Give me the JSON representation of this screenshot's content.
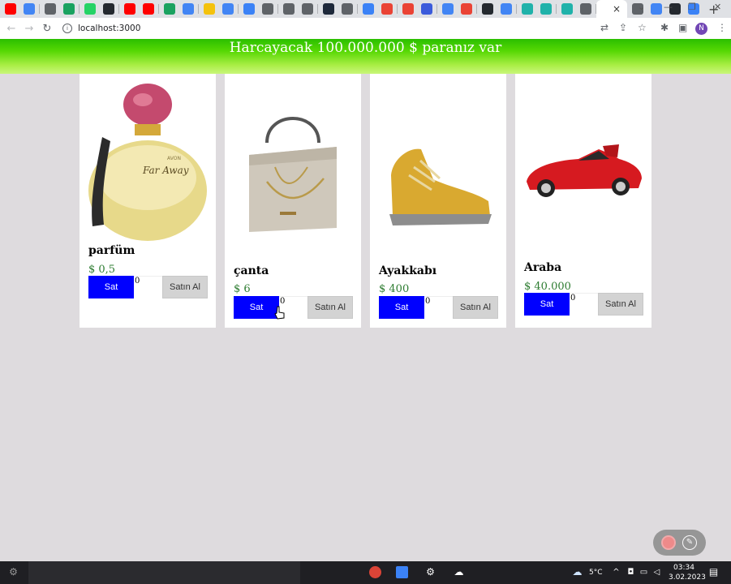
{
  "browser": {
    "url": "localhost:3000",
    "profile_initial": "N",
    "tab_favicon_colors": [
      "#ff0000",
      "#4285f4",
      "#5f6368",
      "#1aa260",
      "#25d366",
      "#24292f",
      "#ff0000",
      "#ff0000",
      "#1aa260",
      "#4285f4",
      "#f4c20d",
      "#4285f4",
      "#3b82f6",
      "#5f6368",
      "#5f6368",
      "#5f6368",
      "#1e293b",
      "#5f6368",
      "#3b82f6",
      "#ea4335",
      "#ea4335",
      "#3b5bdb",
      "#4285f4",
      "#ea4335",
      "#24292f",
      "#4285f4",
      "#20b2aa",
      "#20b2aa",
      "#20b2aa",
      "#5f6368"
    ],
    "after_active_tab_favicon_colors": [
      "#5f6368",
      "#4285f4",
      "#24292f",
      "#3b82f6"
    ],
    "close_tab_icon": "×",
    "new_tab_icon": "+",
    "window_minimize": "—",
    "window_restore": "❐",
    "window_close": "✕",
    "tab_search_icon": "⌄"
  },
  "header": {
    "budget_text": "Harcayacak 100.000.000 $ paranız var"
  },
  "products": [
    {
      "name": "parfüm",
      "price": "$ 0,5",
      "sell_label": "Sat",
      "quantity": "0",
      "buy_label": "Satın Al"
    },
    {
      "name": "çanta",
      "price": "$ 6",
      "sell_label": "Sat",
      "quantity": "0",
      "buy_label": "Satın Al"
    },
    {
      "name": "Ayakkabı",
      "price": "$ 400",
      "sell_label": "Sat",
      "quantity": "0",
      "buy_label": "Satın Al"
    },
    {
      "name": "Araba",
      "price": "$ 40.000",
      "sell_label": "Sat",
      "quantity": "0",
      "buy_label": "Satın Al"
    }
  ],
  "taskbar": {
    "temperature": "5°C",
    "time": "03:34",
    "date": "3.02.2023"
  },
  "colors": {
    "sell_button": "#0000ff",
    "buy_button": "#d3d3d3",
    "price_text": "#2e7d32",
    "banner_top": "#2bbf00",
    "banner_bottom": "#c9f67a",
    "page_background": "#dedbde"
  }
}
